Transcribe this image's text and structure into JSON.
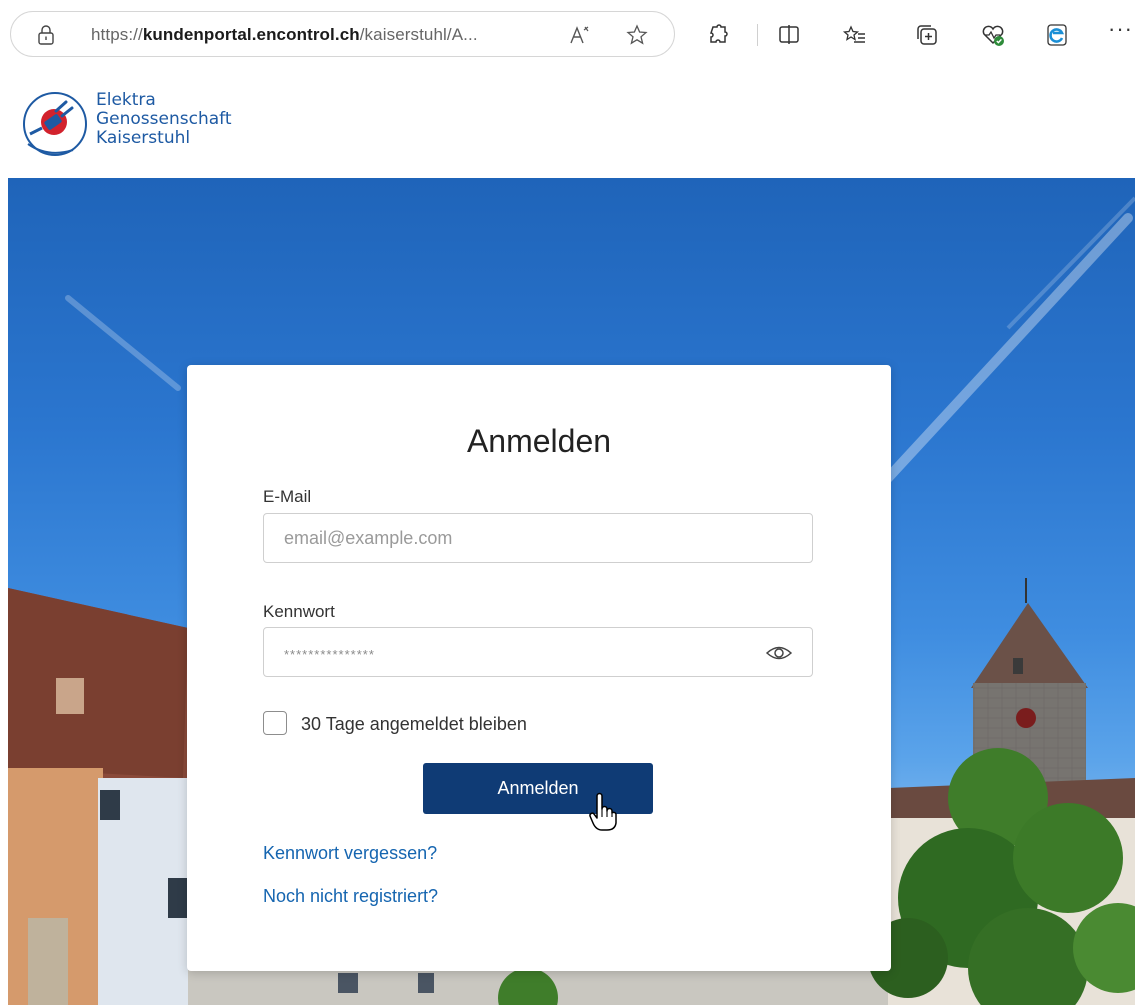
{
  "browser": {
    "url_prefix": "https://",
    "url_host": "kundenportal.encontrol.ch",
    "url_rest": "/kaiserstuhl/A...",
    "icons": [
      "lock-icon",
      "read-aloud-icon",
      "favorite-star-icon",
      "extensions-icon",
      "split-screen-icon",
      "favorites-list-icon",
      "collections-icon",
      "browser-essentials-icon",
      "edge-icon",
      "more-icon"
    ],
    "more_label": "···"
  },
  "site": {
    "logo_lines": [
      "Elektra",
      "Genossenschaft",
      "Kaiserstuhl"
    ],
    "brand_color": "#1e5aa3"
  },
  "login": {
    "title": "Anmelden",
    "email_label": "E-Mail",
    "email_placeholder": "email@example.com",
    "password_label": "Kennwort",
    "password_mask": "***************",
    "remember_label": "30 Tage angemeldet bleiben",
    "remember_checked": false,
    "submit_label": "Anmelden",
    "forgot_link": "Kennwort vergessen?",
    "register_link": "Noch nicht registriert?"
  },
  "colors": {
    "button": "#0f3b75",
    "link": "#1565b0"
  }
}
